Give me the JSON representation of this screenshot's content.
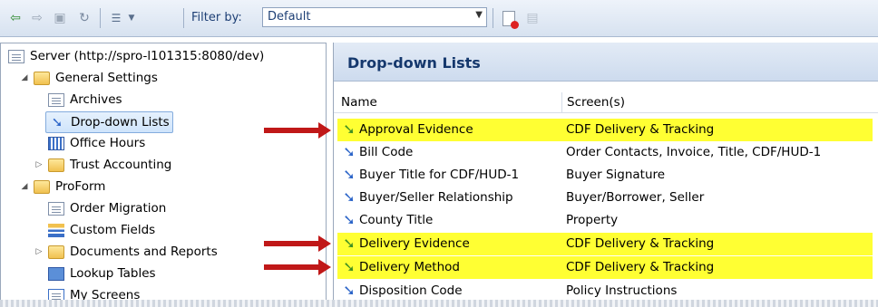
{
  "toolbar": {
    "icons": [
      "back-icon",
      "forward-icon",
      "folder-up-icon",
      "refresh-icon",
      "view-list-icon",
      "dropdown-caret-icon",
      "new-document-icon",
      "properties-icon"
    ],
    "filter_label": "Filter by:",
    "filter_value": "Default"
  },
  "tree": {
    "items": [
      {
        "label": "Server (http://spro-l101315:8080/dev)",
        "icon": "server-icon"
      },
      {
        "label": "General Settings",
        "icon": "folder-open-icon",
        "expander": "◢"
      },
      {
        "label": "Archives",
        "icon": "document-icon"
      },
      {
        "label": "Drop-down Lists",
        "icon": "blue-arrow-icon",
        "selected": true
      },
      {
        "label": "Office Hours",
        "icon": "grid-icon"
      },
      {
        "label": "Trust Accounting",
        "icon": "folder-icon",
        "expander": "▷"
      },
      {
        "label": "ProForm",
        "icon": "folder-open-icon",
        "expander": "◢"
      },
      {
        "label": "Order Migration",
        "icon": "migration-icon"
      },
      {
        "label": "Custom Fields",
        "icon": "fields-icon"
      },
      {
        "label": "Documents and Reports",
        "icon": "folder-icon",
        "expander": "▷"
      },
      {
        "label": "Lookup Tables",
        "icon": "table-icon"
      },
      {
        "label": "My Screens",
        "icon": "screens-icon"
      }
    ]
  },
  "panel": {
    "title": "Drop-down Lists",
    "columns": {
      "name": "Name",
      "screens": "Screen(s)"
    },
    "rows": [
      {
        "name": "Approval Evidence",
        "screens": "CDF Delivery & Tracking",
        "highlight": true
      },
      {
        "name": "Bill Code",
        "screens": "Order Contacts, Invoice, Title, CDF/HUD-1",
        "highlight": false
      },
      {
        "name": "Buyer Title for CDF/HUD-1",
        "screens": "Buyer Signature",
        "highlight": false
      },
      {
        "name": "Buyer/Seller Relationship",
        "screens": "Buyer/Borrower, Seller",
        "highlight": false
      },
      {
        "name": "County Title",
        "screens": "Property",
        "highlight": false
      },
      {
        "name": "Delivery Evidence",
        "screens": "CDF Delivery & Tracking",
        "highlight": true
      },
      {
        "name": "Delivery Method",
        "screens": "CDF Delivery & Tracking",
        "highlight": true
      },
      {
        "name": "Disposition Code",
        "screens": "Policy Instructions",
        "highlight": false
      }
    ]
  },
  "colors": {
    "highlight": "#ffff33",
    "annotation_arrow": "#c01818",
    "title_text": "#15386d"
  }
}
